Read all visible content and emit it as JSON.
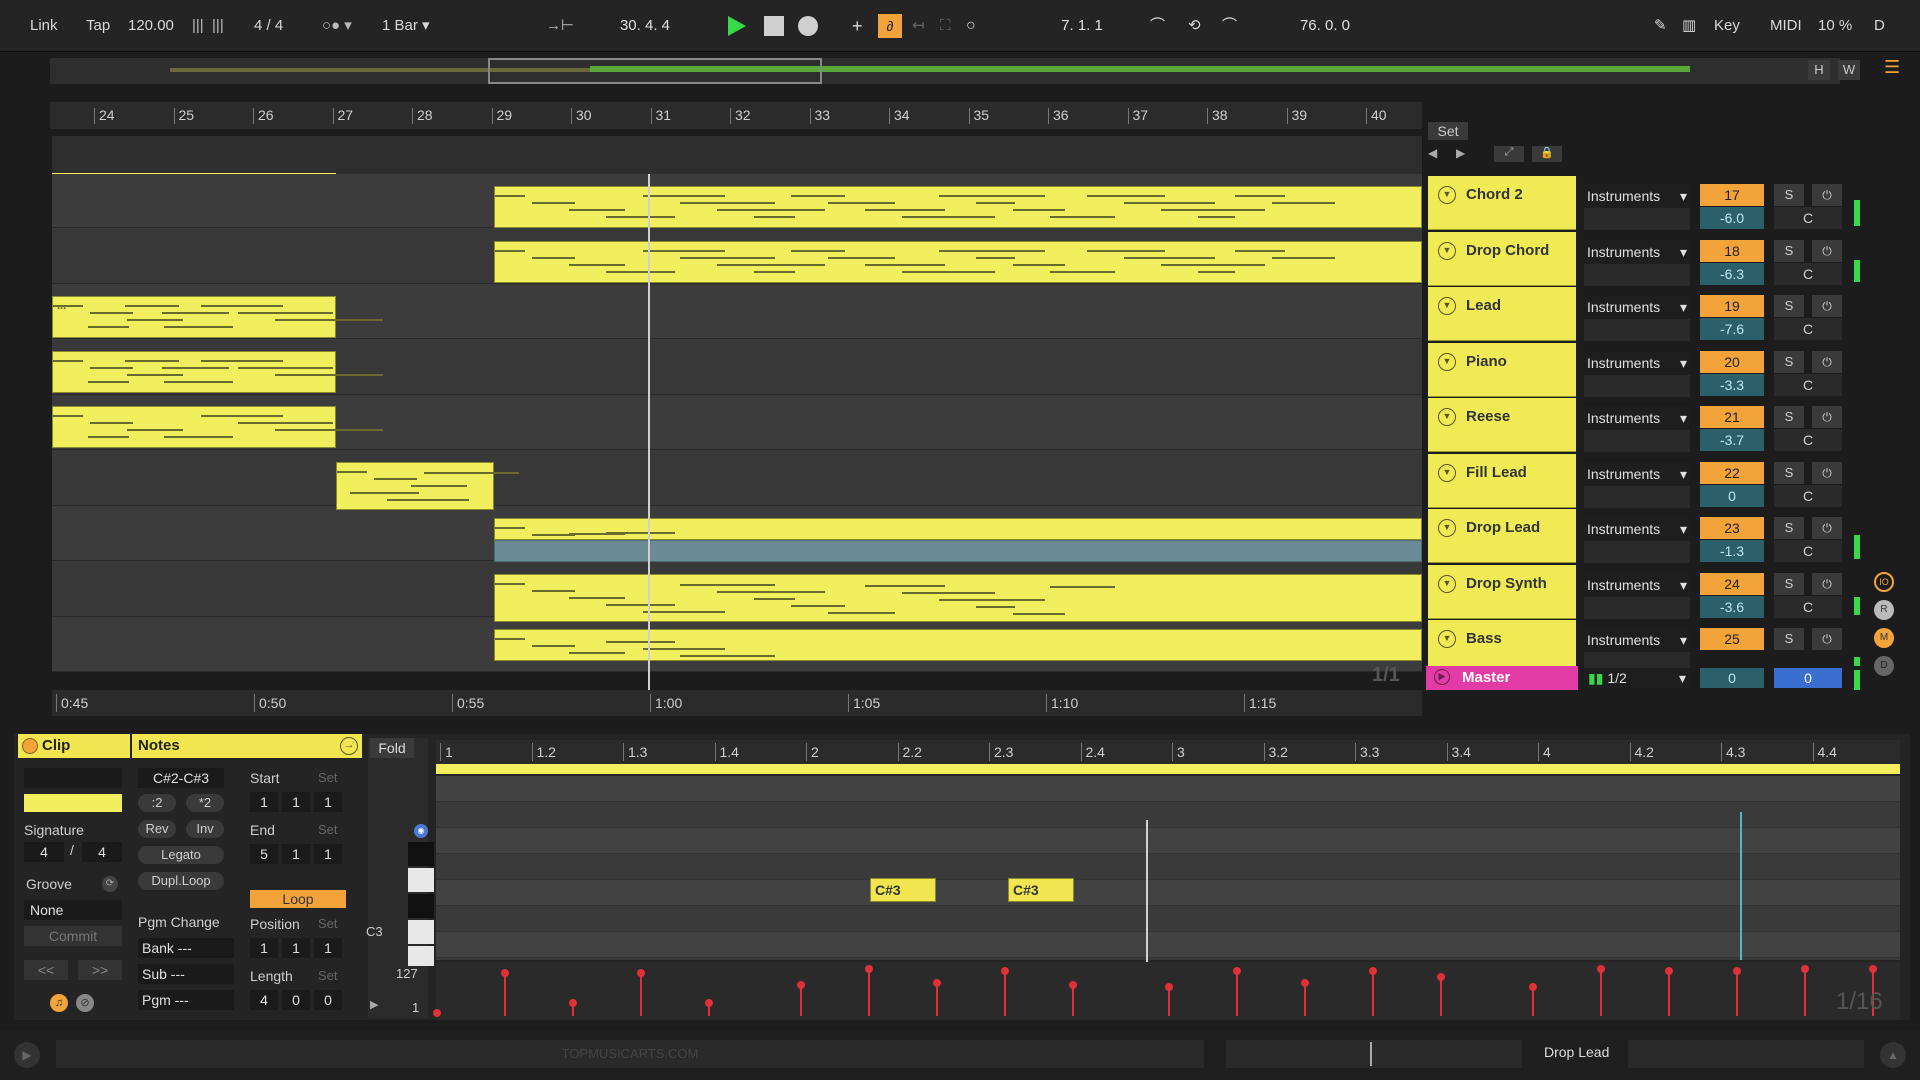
{
  "transport": {
    "link": "Link",
    "tap": "Tap",
    "tempo": "120.00",
    "time_sig": "4 / 4",
    "quantize": "1 Bar",
    "position": "30.  4.  4",
    "loop_start": "7.  1.  1",
    "loop_length": "76.  0.  0",
    "key": "Key",
    "midi": "MIDI",
    "cpu": "10 %",
    "d": "D",
    "h": "H",
    "w": "W"
  },
  "ruler": {
    "bars": [
      "24",
      "25",
      "26",
      "27",
      "28",
      "29",
      "30",
      "31",
      "32",
      "33",
      "34",
      "35",
      "36",
      "37",
      "38",
      "39",
      "40"
    ],
    "set_label": "Set"
  },
  "time_ruler": [
    "0:45",
    "0:50",
    "0:55",
    "1:00",
    "1:05",
    "1:10",
    "1:15"
  ],
  "tracks": [
    {
      "name": "Chord 2",
      "input": "Instruments",
      "num": "17",
      "volume": "-6.0",
      "pan": "C",
      "solo": "S",
      "meter": 0.6
    },
    {
      "name": "Drop Chord",
      "input": "Instruments",
      "num": "18",
      "volume": "-6.3",
      "pan": "C",
      "solo": "S",
      "meter": 0.5
    },
    {
      "name": "Lead",
      "input": "Instruments",
      "num": "19",
      "volume": "-7.6",
      "pan": "C",
      "solo": "S",
      "meter": 0
    },
    {
      "name": "Piano",
      "input": "Instruments",
      "num": "20",
      "volume": "-3.3",
      "pan": "C",
      "solo": "S",
      "meter": 0
    },
    {
      "name": "Reese",
      "input": "Instruments",
      "num": "21",
      "volume": "-3.7",
      "pan": "C",
      "solo": "S",
      "meter": 0
    },
    {
      "name": "Fill Lead",
      "input": "Instruments",
      "num": "22",
      "volume": "0",
      "pan": "C",
      "solo": "S",
      "meter": 0
    },
    {
      "name": "Drop Lead",
      "input": "Instruments",
      "num": "23",
      "volume": "-1.3",
      "pan": "C",
      "solo": "S",
      "meter": 0.55
    },
    {
      "name": "Drop Synth",
      "input": "Instruments",
      "num": "24",
      "volume": "-3.6",
      "pan": "C",
      "solo": "S",
      "meter": 0.4
    },
    {
      "name": "Bass",
      "input": "Instruments",
      "num": "25",
      "volume": "",
      "pan": "",
      "solo": "S",
      "meter": 0.3
    }
  ],
  "master": {
    "name": "Master",
    "input": "1/2",
    "volume": "0",
    "pan": "0"
  },
  "page_indicator": "1/1",
  "clip_panel": {
    "title": "Clip",
    "signature_label": "Signature",
    "sig_num": "4",
    "sig_slash": "/",
    "sig_den": "4",
    "groove_label": "Groove",
    "groove_value": "None",
    "commit": "Commit",
    "prev": "<<",
    "next": ">>"
  },
  "notes_panel": {
    "title": "Notes",
    "range": "C#2-C#3",
    "div2": ":2",
    "mul2": "*2",
    "rev": "Rev",
    "inv": "Inv",
    "legato": "Legato",
    "dupl_loop": "Dupl.Loop",
    "pgm_change": "Pgm Change",
    "bank": "Bank ---",
    "sub": "Sub ---",
    "pgm": "Pgm ---",
    "start_label": "Start",
    "end_label": "End",
    "set": "Set",
    "start": [
      "1",
      "1",
      "1"
    ],
    "end": [
      "5",
      "1",
      "1"
    ],
    "loop": "Loop",
    "position_label": "Position",
    "position": [
      "1",
      "1",
      "1"
    ],
    "length_label": "Length",
    "length": [
      "4",
      "0",
      "0"
    ]
  },
  "piano_roll": {
    "fold": "Fold",
    "ruler": [
      "1",
      "1.2",
      "1.3",
      "1.4",
      "2",
      "2.2",
      "2.3",
      "2.4",
      "3",
      "3.2",
      "3.3",
      "3.4",
      "4",
      "4.2",
      "4.3",
      "4.4"
    ],
    "c3_label": "C3",
    "notes": [
      "C#3",
      "C#3"
    ],
    "vel_max": "127",
    "vel_min": "1",
    "grid": "1/16"
  },
  "status": {
    "watermark": "TOPMUSICARTS.COM",
    "selected_track": "Drop Lead"
  },
  "colors": {
    "clip_yellow": "#f2ef5e",
    "track_orange": "#f2a33a",
    "master_pink": "#e23ba6",
    "meter_green": "#37d84a",
    "velocity_red": "#e0303a",
    "play_green": "#37d84a"
  }
}
